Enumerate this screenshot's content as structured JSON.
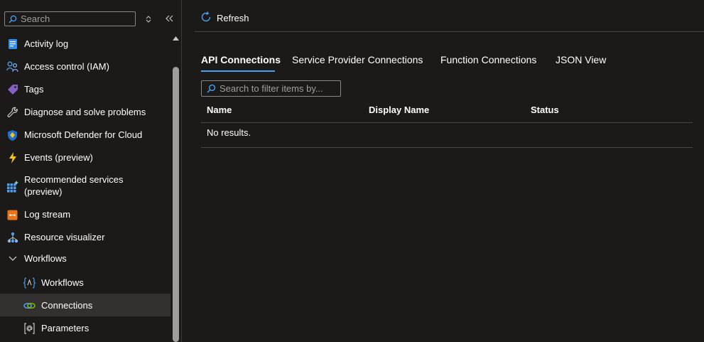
{
  "sidebar": {
    "search_placeholder": "Search",
    "items": [
      {
        "label": "Activity log",
        "icon": "activity-log-icon"
      },
      {
        "label": "Access control (IAM)",
        "icon": "people-icon"
      },
      {
        "label": "Tags",
        "icon": "tag-icon"
      },
      {
        "label": "Diagnose and solve problems",
        "icon": "wrench-icon"
      },
      {
        "label": "Microsoft Defender for Cloud",
        "icon": "shield-icon"
      },
      {
        "label": "Events (preview)",
        "icon": "lightning-icon"
      },
      {
        "label": "Recommended services",
        "label2": "(preview)",
        "icon": "grid-icon"
      },
      {
        "label": "Log stream",
        "icon": "log-stream-icon"
      },
      {
        "label": "Resource visualizer",
        "icon": "hierarchy-icon"
      },
      {
        "label": "Workflows",
        "icon": "chevron-down-icon"
      },
      {
        "label": "Workflows",
        "icon": "workflow-braces-icon"
      },
      {
        "label": "Connections",
        "icon": "connections-icon",
        "active": true
      },
      {
        "label": "Parameters",
        "icon": "parameters-icon"
      }
    ]
  },
  "toolbar": {
    "refresh_label": "Refresh"
  },
  "tabs": [
    {
      "label": "API Connections",
      "active": true
    },
    {
      "label": "Service Provider Connections"
    },
    {
      "label": "Function Connections"
    },
    {
      "label": "JSON View"
    }
  ],
  "filter": {
    "placeholder": "Search to filter items by..."
  },
  "grid": {
    "columns": [
      "Name",
      "Display Name",
      "Status"
    ],
    "empty_text": "No results."
  },
  "colors": {
    "background": "#1b1a19",
    "accent": "#4aa3f0",
    "active_item": "#323130",
    "border": "#8a8886"
  }
}
